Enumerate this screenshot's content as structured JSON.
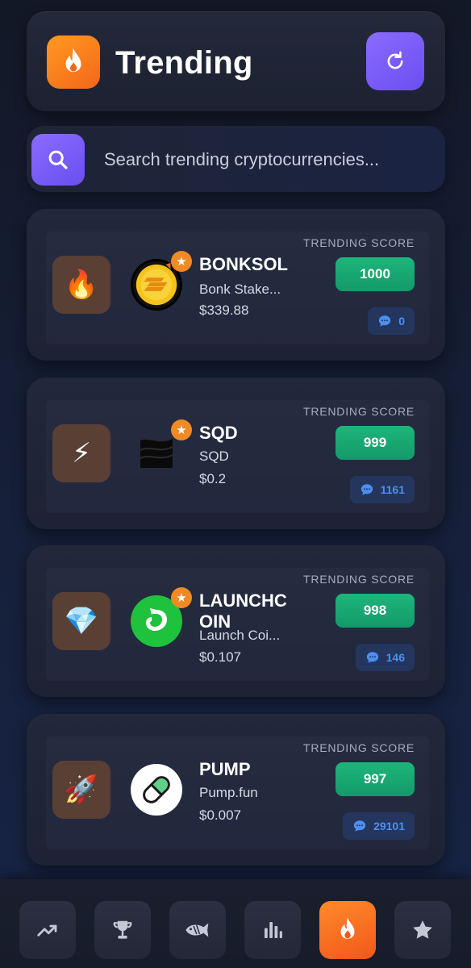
{
  "header": {
    "title": "Trending",
    "logo_icon": "flame-icon",
    "refresh_icon": "refresh-icon"
  },
  "search": {
    "placeholder": "Search trending cryptocurrencies...",
    "icon": "search-icon"
  },
  "score_label": "TRENDING SCORE",
  "coins": [
    {
      "rank_icon": "🔥",
      "symbol": "BONKSOL",
      "name": "Bonk Stake...",
      "price": "$339.88",
      "score": "1000",
      "comments": "0"
    },
    {
      "rank_icon": "⚡",
      "symbol": "SQD",
      "name": "SQD",
      "price": "$0.2",
      "score": "999",
      "comments": "1161"
    },
    {
      "rank_icon": "💎",
      "symbol": "LAUNCHC\nOIN",
      "name": "Launch Coi...",
      "price": "$0.107",
      "score": "998",
      "comments": "146"
    },
    {
      "rank_icon": "🚀",
      "symbol": "PUMP",
      "name": "Pump.fun",
      "price": "$0.007",
      "score": "997",
      "comments": "29101"
    }
  ],
  "nav": {
    "items": [
      "trending-up-icon",
      "trophy-icon",
      "fish-icon",
      "bar-chart-icon",
      "flame-icon",
      "star-icon"
    ],
    "active": "flame-icon"
  },
  "colors": {
    "accent_orange": "#f4661b",
    "accent_purple": "#7b5cff",
    "score_green": "#1db67a",
    "comment_blue": "#4d8ff0"
  }
}
